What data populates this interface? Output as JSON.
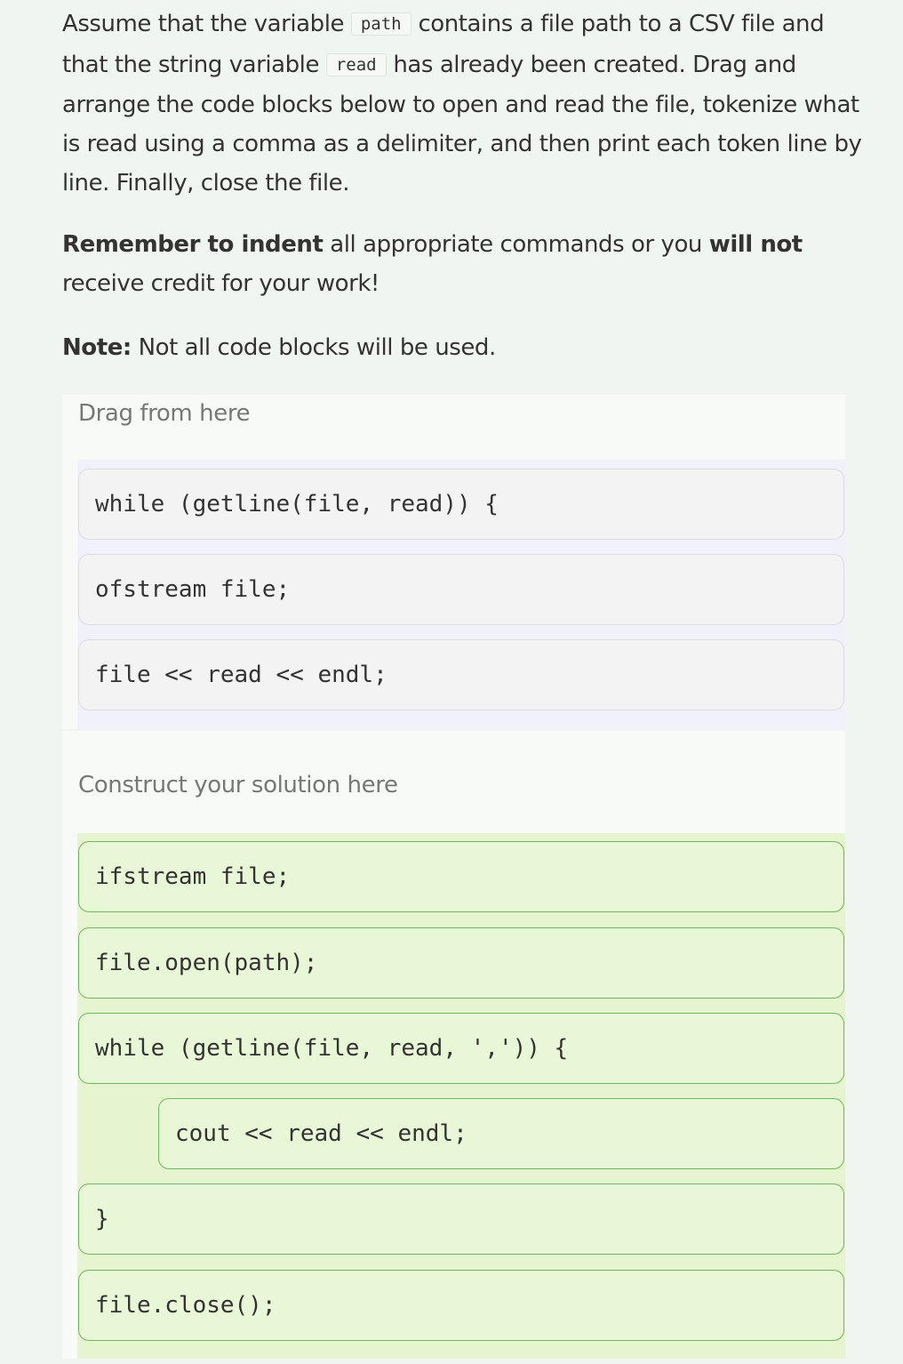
{
  "instructions": {
    "p1_a": "Assume that the variable ",
    "code_path": "path",
    "p1_b": " contains a file path to a CSV file and that the string variable ",
    "code_read": "read",
    "p1_c": " has already been created. Drag and arrange the code blocks below to open and read the file, tokenize what is read using a comma as a delimiter, and then print each token line by line. Finally, close the file.",
    "p2_bold1": "Remember to indent",
    "p2_a": " all appropriate commands or you ",
    "p2_bold2": "will not",
    "p2_b": " receive credit for your work!",
    "p3_bold": "Note:",
    "p3_a": " Not all code blocks will be used."
  },
  "drag_panel": {
    "label": "Drag from here",
    "blocks": [
      "while (getline(file, read)) {",
      "ofstream file;",
      "file << read << endl;"
    ]
  },
  "solution_panel": {
    "label": "Construct your solution here",
    "blocks": [
      "ifstream file;",
      "file.open(path);",
      "while (getline(file, read, ',')) {",
      "cout << read << endl;",
      "}",
      "file.close();"
    ]
  }
}
